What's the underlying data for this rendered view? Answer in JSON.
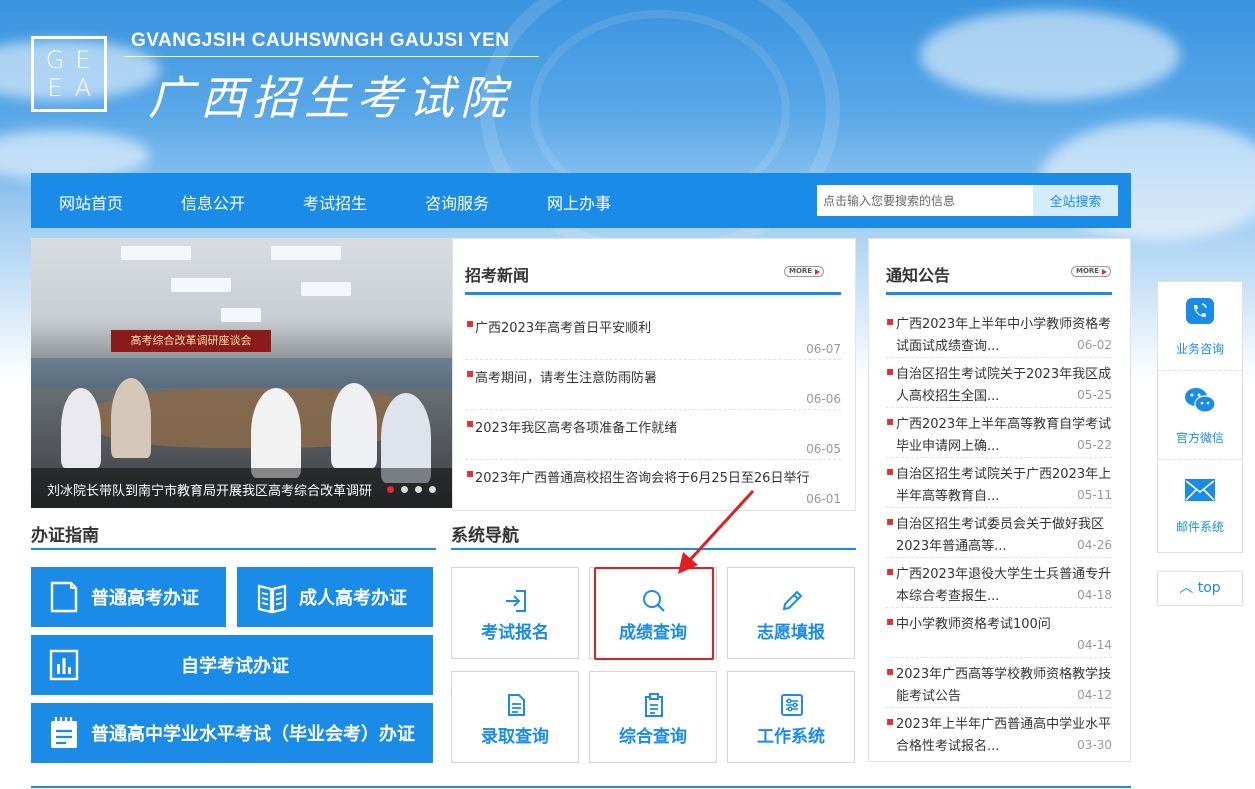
{
  "header": {
    "logo_letters": [
      "G",
      "E",
      "E",
      "A"
    ],
    "english_title": "GVANGJSIH CAUHSWNGH GAUJSI YEN",
    "chinese_title": "广西招生考试院"
  },
  "nav": {
    "items": [
      "网站首页",
      "信息公开",
      "考试招生",
      "咨询服务",
      "网上办事"
    ],
    "search_placeholder": "点击输入您要搜索的信息",
    "search_button": "全站搜索"
  },
  "slideshow": {
    "banner_text": "高考综合改革调研座谈会",
    "caption": "刘冰院长带队到南宁市教育局开展我区高考综合改革调研",
    "dots": 4,
    "active_dot": 0
  },
  "news": {
    "title": "招考新闻",
    "more": "MORE",
    "items": [
      {
        "text": "广西2023年高考首日平安顺利",
        "date": "06-07"
      },
      {
        "text": "高考期间，请考生注意防雨防暑",
        "date": "06-06"
      },
      {
        "text": "2023年我区高考各项准备工作就绪",
        "date": "06-05"
      },
      {
        "text": "2023年广西普通高校招生咨询会将于6月25日至26日举行",
        "date": "06-01"
      }
    ]
  },
  "notices": {
    "title": "通知公告",
    "more": "MORE",
    "items": [
      {
        "text": "广西2023年上半年中小学教师资格考试面试成绩查询...",
        "date": "06-02"
      },
      {
        "text": "自治区招生考试院关于2023年我区成人高校招生全国...",
        "date": "05-25"
      },
      {
        "text": "广西2023年上半年高等教育自学考试毕业申请网上确...",
        "date": "05-22"
      },
      {
        "text": "自治区招生考试院关于广西2023年上半年高等教育自...",
        "date": "05-11"
      },
      {
        "text": "自治区招生考试委员会关于做好我区2023年普通高等...",
        "date": "04-26"
      },
      {
        "text": "广西2023年退役大学生士兵普通专升本综合考查报生...",
        "date": "04-18"
      },
      {
        "text": "中小学教师资格考试100问",
        "date": "04-14"
      },
      {
        "text": "2023年广西高等学校教师资格教学技能考试公告",
        "date": "04-12"
      },
      {
        "text": "2023年上半年广西普通高中学业水平合格性考试报名...",
        "date": "03-30"
      }
    ]
  },
  "guide": {
    "title": "办证指南",
    "buttons": [
      "普通高考办证",
      "成人高考办证",
      "自学考试办证",
      "普通高中学业水平考试（毕业会考）办证"
    ]
  },
  "system_nav": {
    "title": "系统导航",
    "tiles": [
      "考试报名",
      "成绩查询",
      "志愿填报",
      "录取查询",
      "综合查询",
      "工作系统"
    ]
  },
  "side": {
    "items": [
      "业务咨询",
      "官方微信",
      "邮件系统"
    ],
    "top": "top"
  },
  "colors": {
    "primary": "#1a8ce8",
    "highlight": "#e02020"
  }
}
